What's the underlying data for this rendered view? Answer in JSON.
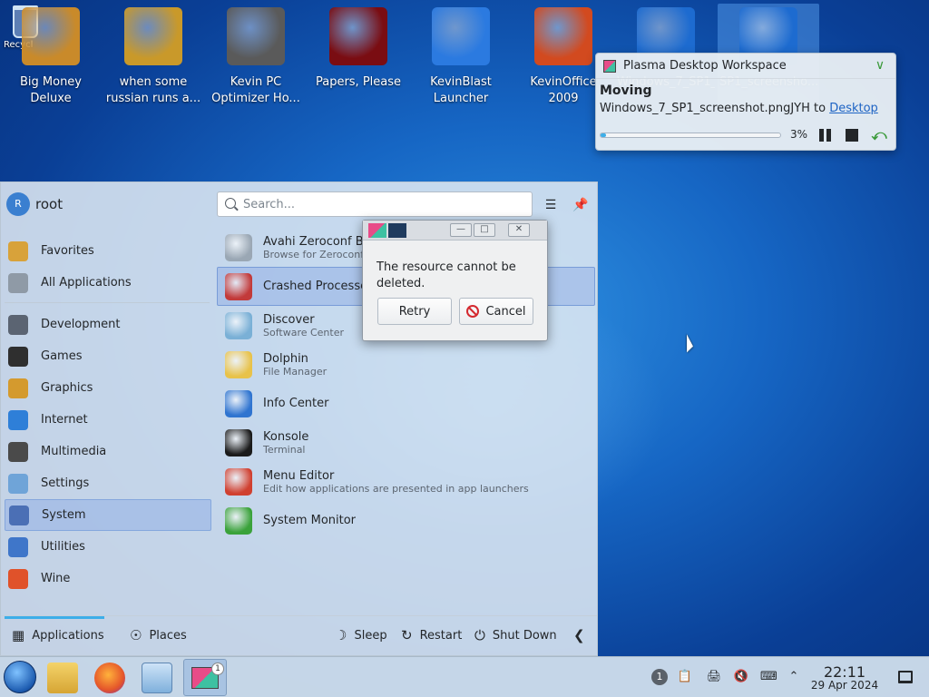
{
  "desktop": {
    "recycle_label": "Recycl",
    "icons": [
      {
        "label": "Big Money Deluxe",
        "color": "#c98a2a"
      },
      {
        "label": "when some russian runs a...",
        "color": "#c9992a"
      },
      {
        "label": "Kevin PC Optimizer Ho...",
        "color": "#5a5a5a"
      },
      {
        "label": "Papers, Please",
        "color": "#7a0d12"
      },
      {
        "label": "KevinBlast Launcher",
        "color": "#2b7ae0"
      },
      {
        "label": "KevinOffice 2009",
        "color": "#d24a1f"
      },
      {
        "label": "Windows_7_SP1_screensho...",
        "color": "#1d6bd0"
      },
      {
        "label": "SP1_screensho...",
        "color": "#1d6bd0"
      }
    ]
  },
  "notification": {
    "app_title": "Plasma Desktop Workspace",
    "heading": "Moving",
    "body_prefix": "Windows_7_SP1_screenshot.pngJYH to ",
    "body_link": "Desktop",
    "percent_text": "3%",
    "progress": 0.03
  },
  "launcher": {
    "username": "root",
    "avatar_letter": "R",
    "search_placeholder": "Search...",
    "categories_top": [
      {
        "label": "Favorites",
        "color": "#d8a23a"
      },
      {
        "label": "All Applications",
        "color": "#8f9aa6"
      }
    ],
    "categories": [
      {
        "label": "Development",
        "color": "#5b6472"
      },
      {
        "label": "Games",
        "color": "#2f2f2f"
      },
      {
        "label": "Graphics",
        "color": "#d49a2e"
      },
      {
        "label": "Internet",
        "color": "#2e7fd8"
      },
      {
        "label": "Multimedia",
        "color": "#4a4a4a"
      },
      {
        "label": "Settings",
        "color": "#6fa4d8"
      },
      {
        "label": "System",
        "color": "#4b6fb5",
        "selected": true
      },
      {
        "label": "Utilities",
        "color": "#3f76c9"
      },
      {
        "label": "Wine",
        "color": "#e0522a"
      }
    ],
    "apps": [
      {
        "name": "Avahi Zeroconf Browser",
        "desc": "Browse for Zeroconf s",
        "color": "#9aa7b4"
      },
      {
        "name": "Crashed Processes",
        "desc": "",
        "color": "#c23a3a",
        "selected": true
      },
      {
        "name": "Discover",
        "desc": "Software Center",
        "color": "#7ab0d6"
      },
      {
        "name": "Dolphin",
        "desc": "File Manager",
        "color": "#e8c24a"
      },
      {
        "name": "Info Center",
        "desc": "",
        "color": "#2f74d0"
      },
      {
        "name": "Konsole",
        "desc": "Terminal",
        "color": "#1b1b1b"
      },
      {
        "name": "Menu Editor",
        "desc": "Edit how applications are presented in app launchers",
        "color": "#d04030"
      },
      {
        "name": "System Monitor",
        "desc": "",
        "color": "#3aa23a"
      }
    ],
    "bottom": {
      "applications": "Applications",
      "places": "Places",
      "sleep": "Sleep",
      "restart": "Restart",
      "shutdown": "Shut Down"
    }
  },
  "dialog": {
    "message": "The resource cannot be deleted.",
    "retry": "Retry",
    "cancel": "Cancel"
  },
  "taskbar": {
    "task_badge": "1",
    "tray_badge": "1",
    "time": "22:11",
    "date": "29 Apr 2024"
  }
}
